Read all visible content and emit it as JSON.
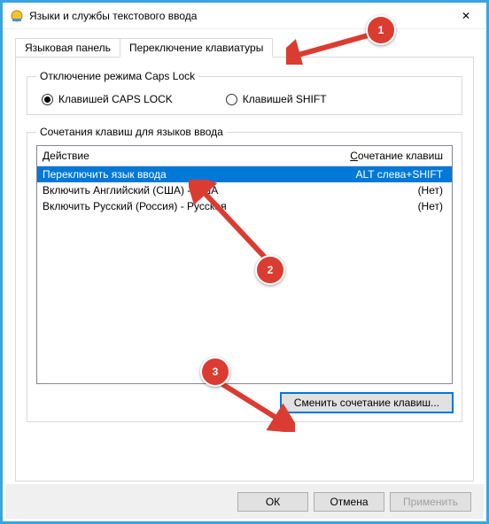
{
  "window": {
    "title": "Языки и службы текстового ввода",
    "close_symbol": "✕"
  },
  "tabs": {
    "language_bar": "Языковая панель",
    "keyboard_switch": "Переключение клавиатуры"
  },
  "caps_lock_group": {
    "legend": "Отключение режима Caps Lock",
    "option_caps": "Клавишей CAPS LOCK",
    "option_shift": "Клавишей SHIFT"
  },
  "hotkeys_group": {
    "legend": "Сочетания клавиш для языков ввода",
    "col_action_prefix": "Д",
    "col_action_rest": "ействие",
    "col_shortcut_prefix": "С",
    "col_shortcut_rest": "очетание клавиш",
    "rows": [
      {
        "action": "Переключить язык ввода",
        "shortcut": "ALT слева+SHIFT"
      },
      {
        "action": "Включить Английский (США) - США",
        "shortcut": "(Нет)"
      },
      {
        "action": "Включить Русский (Россия) - Русская",
        "shortcut": "(Нет)"
      }
    ],
    "change_button": "Сменить сочетание клавиш..."
  },
  "dialog_buttons": {
    "ok": "ОК",
    "cancel": "Отмена",
    "apply": "Применить"
  },
  "annotations": {
    "c1": "1",
    "c2": "2",
    "c3": "3"
  }
}
